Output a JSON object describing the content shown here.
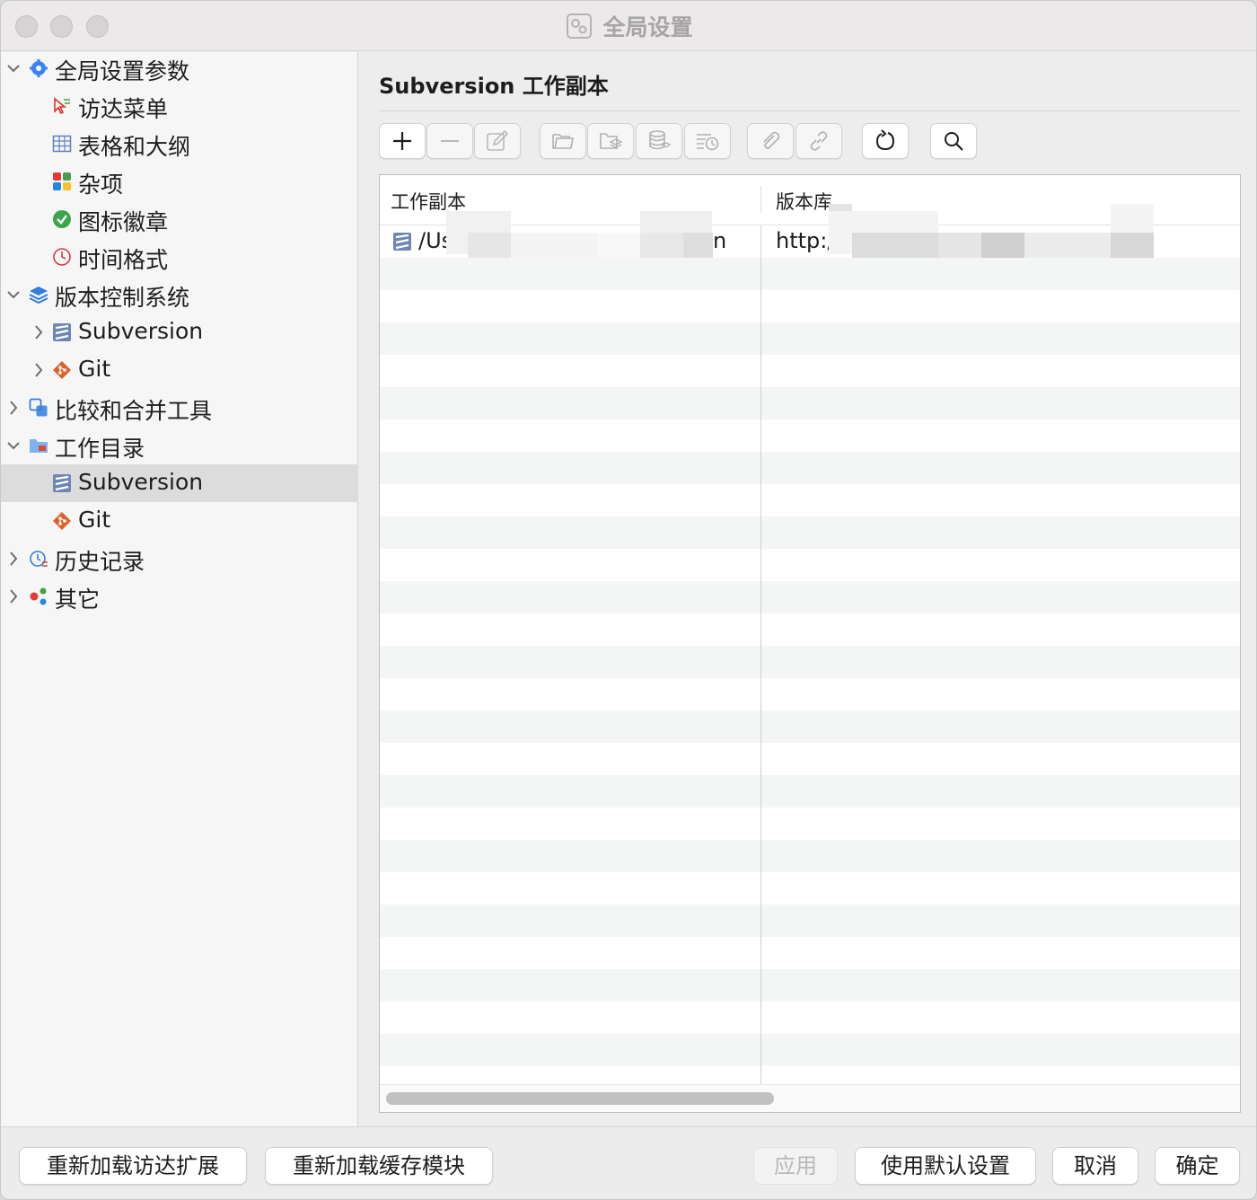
{
  "window": {
    "title": "全局设置"
  },
  "sidebar": {
    "items": [
      {
        "label": "全局设置参数",
        "expanded": true,
        "icon": "gear-icon"
      },
      {
        "label": "访达菜单",
        "icon": "finder-menu-icon"
      },
      {
        "label": "表格和大纲",
        "icon": "table-icon"
      },
      {
        "label": "杂项",
        "icon": "misc-grid-icon"
      },
      {
        "label": "图标徽章",
        "icon": "check-badge-icon"
      },
      {
        "label": "时间格式",
        "icon": "clock-icon"
      },
      {
        "label": "版本控制系统",
        "expanded": true,
        "icon": "layers-icon"
      },
      {
        "label": "Subversion",
        "expanded": false,
        "icon": "subversion-icon"
      },
      {
        "label": "Git",
        "expanded": false,
        "icon": "git-icon"
      },
      {
        "label": "比较和合并工具",
        "expanded": false,
        "icon": "diff-icon"
      },
      {
        "label": "工作目录",
        "expanded": true,
        "icon": "folder-icon"
      },
      {
        "label": "Subversion",
        "selected": true,
        "icon": "subversion-icon"
      },
      {
        "label": "Git",
        "icon": "git-icon"
      },
      {
        "label": "历史记录",
        "expanded": false,
        "icon": "history-icon"
      },
      {
        "label": "其它",
        "expanded": false,
        "icon": "other-dots-icon"
      }
    ]
  },
  "main": {
    "title": "Subversion 工作副本",
    "toolbar": {
      "buttons": [
        {
          "name": "add",
          "icon": "plus-icon",
          "enabled": true
        },
        {
          "name": "remove",
          "icon": "minus-icon",
          "enabled": false
        },
        {
          "name": "edit",
          "icon": "pencil-icon",
          "enabled": false
        },
        {
          "name": "open-folder",
          "icon": "folder-open-icon",
          "enabled": false
        },
        {
          "name": "folder-repo",
          "icon": "folder-stack-icon",
          "enabled": false
        },
        {
          "name": "repository",
          "icon": "database-icon",
          "enabled": false
        },
        {
          "name": "log",
          "icon": "log-history-icon",
          "enabled": false
        },
        {
          "name": "attach",
          "icon": "paperclip-icon",
          "enabled": false
        },
        {
          "name": "link",
          "icon": "link-icon",
          "enabled": false
        },
        {
          "name": "refresh",
          "icon": "refresh-icon",
          "enabled": true
        },
        {
          "name": "search",
          "icon": "search-icon",
          "enabled": true
        }
      ]
    },
    "table": {
      "columns": [
        "工作副本",
        "版本库"
      ],
      "rows": [
        {
          "working_copy": "/Us",
          "working_copy_tail": "n",
          "repository": "http:/"
        }
      ]
    }
  },
  "footer": {
    "reload_finder": "重新加载访达扩展",
    "reload_cache": "重新加载缓存模块",
    "apply": "应用",
    "defaults": "使用默认设置",
    "cancel": "取消",
    "ok": "确定"
  },
  "colors": {
    "selection": "#dcdcdc",
    "accent_blue": "#3b82f6",
    "git_orange": "#e0602a",
    "svn_blue": "#6f86b4"
  }
}
